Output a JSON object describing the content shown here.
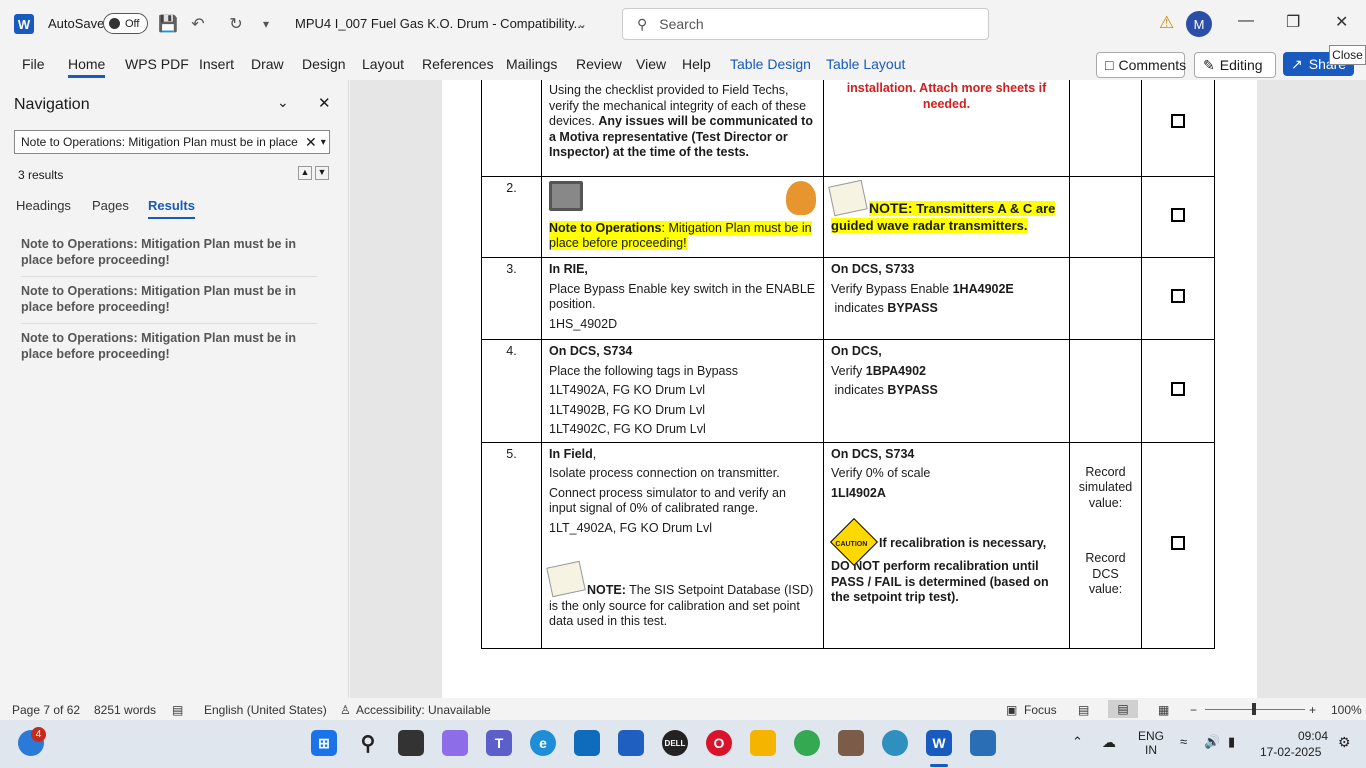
{
  "titlebar": {
    "app_letter": "W",
    "autosave_label": "AutoSave",
    "autosave_state": "Off",
    "doc_title": "MPU4 I_007 Fuel Gas K.O. Drum  -  Compatibility...",
    "search_placeholder": "Search",
    "avatar_initial": "M",
    "close_tooltip": "Close"
  },
  "ribbon": {
    "tabs": [
      "File",
      "Home",
      "WPS PDF",
      "Insert",
      "Draw",
      "Design",
      "Layout",
      "References",
      "Mailings",
      "Review",
      "View",
      "Help",
      "Table Design",
      "Table Layout"
    ],
    "comments_label": "Comments",
    "editing_label": "Editing",
    "share_label": "Share"
  },
  "navigation": {
    "title": "Navigation",
    "search_value": "Note to Operations: Mitigation Plan must be in place",
    "result_count": "3 results",
    "tabs": [
      "Headings",
      "Pages",
      "Results"
    ],
    "results": [
      "Note to Operations: Mitigation Plan must be in place before proceeding!",
      "Note to Operations: Mitigation Plan must be in place before proceeding!",
      "Note to Operations: Mitigation Plan must be in place before proceeding!"
    ]
  },
  "document": {
    "row1": {
      "c2_text": "Using the checklist provided to Field Techs, verify the mechanical integrity of each of these devices.",
      "c2_bold": "Any issues will be communicated to a Motiva representative (Test Director or Inspector) at the time of the tests.",
      "c3_red": "installation. Attach more sheets if needed."
    },
    "row2": {
      "num": "2.",
      "note_label": "Note to Operations",
      "note_text": ": Mitigation Plan must be in place before proceeding!",
      "c3_label": "NOTE:",
      "c3_text": "Transmitters A & C are guided wave radar transmitters."
    },
    "row3": {
      "num": "3.",
      "c2_head": "In RIE,",
      "c2_line1": "Place Bypass Enable key switch in the ENABLE position.",
      "c2_line2": "1HS_4902D",
      "c3_head": "On DCS, S733",
      "c3_line1": "Verify Bypass Enable",
      "c3_tag": "1HA4902E",
      "c3_line2": "indicates",
      "c3_status": "BYPASS"
    },
    "row4": {
      "num": "4.",
      "c2_head": "On DCS, S734",
      "c2_lines": [
        "Place the following tags in Bypass",
        "1LT4902A, FG KO Drum Lvl",
        "1LT4902B, FG KO Drum Lvl",
        "1LT4902C, FG KO Drum Lvl"
      ],
      "c3_head": "On DCS,",
      "c3_line1": "Verify",
      "c3_tag": "1BPA4902",
      "c3_line2": "indicates",
      "c3_status": "BYPASS"
    },
    "row5": {
      "num": "5.",
      "c2_head": "In Field",
      "c2_lines": [
        "Isolate process connection on transmitter.",
        "Connect process simulator to and verify an input signal of 0% of calibrated range.",
        "1LT_4902A, FG KO Drum Lvl"
      ],
      "c2_note_label": "NOTE:",
      "c2_note_text": "The SIS Setpoint Database (ISD) is the only source for calibration and set point data used in this test.",
      "c3_head": "On DCS, S734",
      "c3_line1": "Verify 0% of scale",
      "c3_tag": "1LI4902A",
      "caution_label": "CAUTION",
      "c3_caution": "If recalibration is necessary, DO NOT perform recalibration until PASS / FAIL is determined (based on the setpoint trip test).",
      "c4_top": "Record simulated value:",
      "c4_bottom": "Record DCS value:"
    }
  },
  "statusbar": {
    "page": "Page 7 of 62",
    "words": "8251 words",
    "language": "English (United States)",
    "accessibility": "Accessibility: Unavailable",
    "focus": "Focus",
    "zoom": "100%"
  },
  "taskbar": {
    "notif_count": "4",
    "lang_top": "ENG",
    "lang_bottom": "IN",
    "time": "09:04",
    "date": "17-02-2025"
  }
}
